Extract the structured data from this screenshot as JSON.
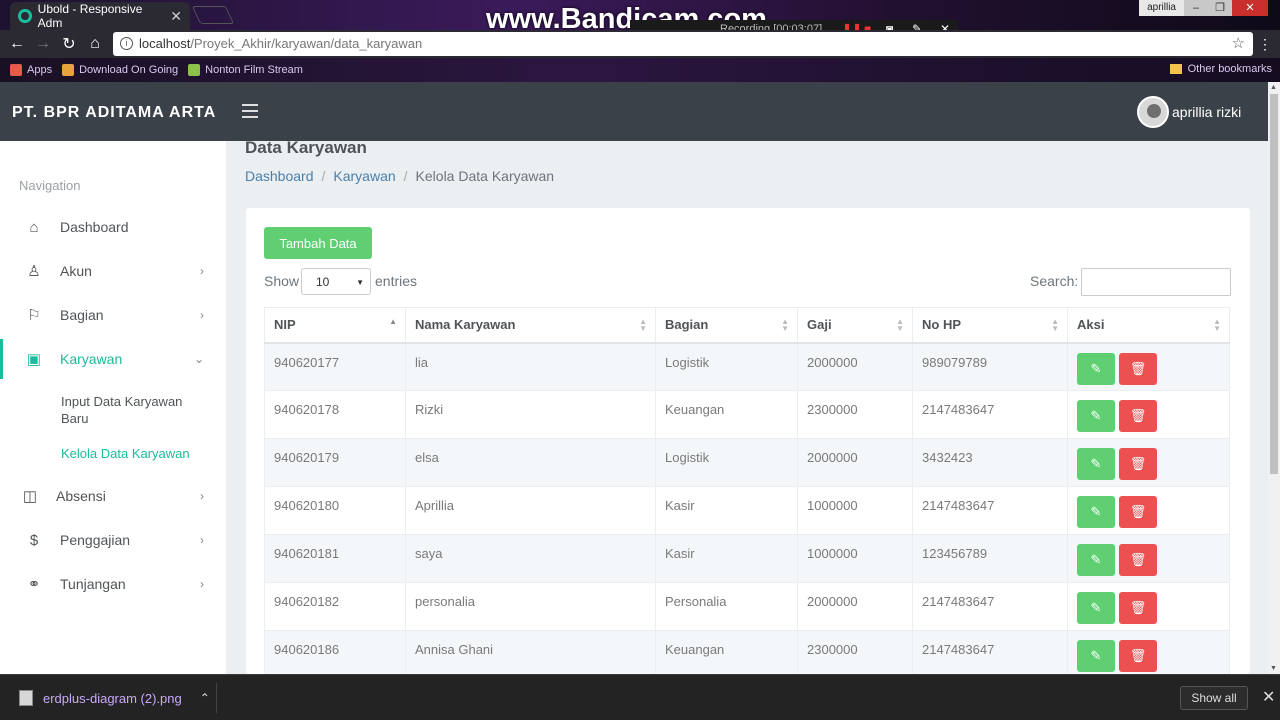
{
  "browser": {
    "tab_title": "Ubold - Responsive Adm",
    "url_host": "localhost",
    "url_path": "/Proyek_Akhir/karyawan/data_karyawan",
    "bookmarks": [
      "Apps",
      "Download On Going",
      "Nonton Film Stream"
    ],
    "other_bookmarks": "Other bookmarks",
    "os_user": "aprillia"
  },
  "recorder": {
    "watermark": "www.Bandicam.com",
    "status": "Recording [00:03:07]"
  },
  "app": {
    "brand": "PT. BPR ADITAMA ARTA",
    "user_name": "aprillia rizki"
  },
  "sidebar": {
    "heading": "Navigation",
    "items": [
      {
        "label": "Dashboard",
        "icon": "home-icon"
      },
      {
        "label": "Akun",
        "icon": "user-icon"
      },
      {
        "label": "Bagian",
        "icon": "signpost-icon"
      },
      {
        "label": "Karyawan",
        "icon": "id-card-icon"
      },
      {
        "label": "Absensi",
        "icon": "book-icon"
      },
      {
        "label": "Penggajian",
        "icon": "dollar-icon"
      },
      {
        "label": "Tunjangan",
        "icon": "handshake-icon"
      }
    ],
    "subitems": [
      "Input Data Karyawan Baru",
      "Kelola Data Karyawan"
    ]
  },
  "page": {
    "title": "Data Karyawan",
    "breadcrumb": [
      "Dashboard",
      "Karyawan",
      "Kelola Data Karyawan"
    ],
    "add_button": "Tambah Data",
    "show_label": "Show",
    "entries_value": "10",
    "entries_label": "entries",
    "search_label": "Search:",
    "search_value": ""
  },
  "table": {
    "columns": [
      "NIP",
      "Nama Karyawan",
      "Bagian",
      "Gaji",
      "No HP",
      "Aksi"
    ],
    "rows": [
      [
        "940620177",
        "lia",
        "Logistik",
        "2000000",
        "989079789"
      ],
      [
        "940620178",
        "Rizki",
        "Keuangan",
        "2300000",
        "2147483647"
      ],
      [
        "940620179",
        "elsa",
        "Logistik",
        "2000000",
        "3432423"
      ],
      [
        "940620180",
        "Aprillia",
        "Kasir",
        "1000000",
        "2147483647"
      ],
      [
        "940620181",
        "saya",
        "Kasir",
        "1000000",
        "123456789"
      ],
      [
        "940620182",
        "personalia",
        "Personalia",
        "2000000",
        "2147483647"
      ],
      [
        "940620186",
        "Annisa Ghani",
        "Keuangan",
        "2300000",
        "2147483647"
      ]
    ]
  },
  "downloads": {
    "file_name": "erdplus-diagram (2).png",
    "show_all": "Show all"
  },
  "colors": {
    "accent": "#1abc9c",
    "topbar": "#3a4149",
    "success": "#5fcf72",
    "danger": "#ec5050"
  }
}
